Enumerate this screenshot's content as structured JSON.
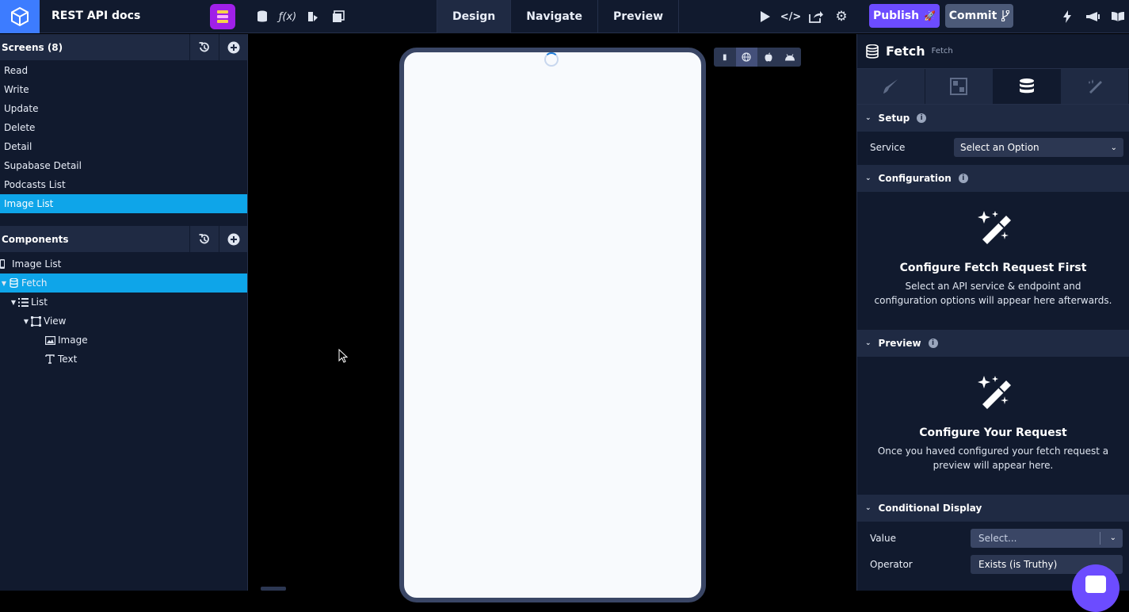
{
  "app": {
    "title": "REST API docs"
  },
  "topbar": {
    "tabs": [
      {
        "label": "Design",
        "active": true
      },
      {
        "label": "Navigate",
        "active": false
      },
      {
        "label": "Preview",
        "active": false
      }
    ],
    "publish_label": "Publish",
    "commit_label": "Commit"
  },
  "screens": {
    "title": "Screens (8)",
    "items": [
      {
        "label": "Read"
      },
      {
        "label": "Write"
      },
      {
        "label": "Update"
      },
      {
        "label": "Delete"
      },
      {
        "label": "Detail"
      },
      {
        "label": "Supabase Detail"
      },
      {
        "label": "Podcasts List"
      },
      {
        "label": "Image List"
      }
    ]
  },
  "components": {
    "title": "Components",
    "tree": [
      {
        "label": "Image List",
        "icon": "phone-icon"
      },
      {
        "label": "Fetch",
        "icon": "database-icon"
      },
      {
        "label": "List",
        "icon": "list-icon"
      },
      {
        "label": "View",
        "icon": "view-icon"
      },
      {
        "label": "Image",
        "icon": "image-icon"
      },
      {
        "label": "Text",
        "icon": "text-icon"
      }
    ]
  },
  "inspector": {
    "name": "Fetch",
    "sub": "Fetch",
    "sections": {
      "setup": "Setup",
      "configuration": "Configuration",
      "preview": "Preview",
      "conditional": "Conditional Display"
    },
    "service_label": "Service",
    "service_value": "Select an Option",
    "config_heading": "Configure Fetch Request First",
    "config_text": "Select an API service & endpoint and configuration options will appear here afterwards.",
    "preview_heading": "Configure Your Request",
    "preview_text": "Once you haved configured your fetch request a preview will appear here.",
    "value_label": "Value",
    "value_placeholder": "Select...",
    "operator_label": "Operator",
    "operator_value": "Exists (is Truthy)"
  },
  "colors": {
    "accent": "#0ea5e9",
    "publish": "#6c4cff",
    "panel": "#111a2e"
  }
}
